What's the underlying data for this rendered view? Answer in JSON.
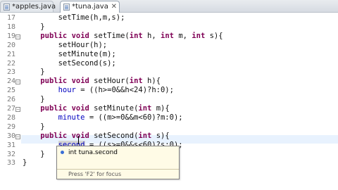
{
  "tabs": [
    {
      "label": "*apples.java",
      "close": "",
      "active": false
    },
    {
      "label": "*tuna.java",
      "close": "✕",
      "active": true
    }
  ],
  "line_numbers": [
    "17",
    "18",
    "19",
    "20",
    "21",
    "22",
    "23",
    "24",
    "25",
    "26",
    "27",
    "28",
    "29",
    "30",
    "31",
    "32",
    "33"
  ],
  "code_lines": [
    [
      "        setTime(h,m,s);"
    ],
    [
      "    }"
    ],
    [
      "    ",
      {
        "kw": "public"
      },
      " ",
      {
        "kw": "void"
      },
      " setTime(",
      {
        "kw": "int"
      },
      " h, ",
      {
        "kw": "int"
      },
      " m, ",
      {
        "kw": "int"
      },
      " s){"
    ],
    [
      "        setHour(h);"
    ],
    [
      "        setMinute(m);"
    ],
    [
      "        setSecond(s);"
    ],
    [
      "    }"
    ],
    [
      "    ",
      {
        "kw": "public"
      },
      " ",
      {
        "kw": "void"
      },
      " setHour(",
      {
        "kw": "int"
      },
      " h){"
    ],
    [
      "        ",
      {
        "fld": "hour"
      },
      " = ((h>=0&&h<24)?h:0);"
    ],
    [
      "    }"
    ],
    [
      "    ",
      {
        "kw": "public"
      },
      " ",
      {
        "kw": "void"
      },
      " setMinute(",
      {
        "kw": "int"
      },
      " m){"
    ],
    [
      "        ",
      {
        "fld": "minute"
      },
      " = ((m>=0&&m<60)?m:0);"
    ],
    [
      "    }"
    ],
    [
      "    ",
      {
        "kw": "public"
      },
      " ",
      {
        "kw": "void"
      },
      " setSecond(",
      {
        "kw": "int"
      },
      " s){"
    ],
    [
      "        ",
      {
        "occ": "second"
      },
      " = ((s>=0&&s<60)?s:0);"
    ],
    [
      "    }"
    ],
    [
      "}"
    ]
  ],
  "popup": {
    "item": "int tuna.second",
    "status": "Press 'F2' for focus"
  },
  "colors": {
    "keyword": "#7f0055",
    "field": "#0000c0",
    "current_line": "#e8f2fe",
    "popup_bg": "#fffbe6"
  }
}
